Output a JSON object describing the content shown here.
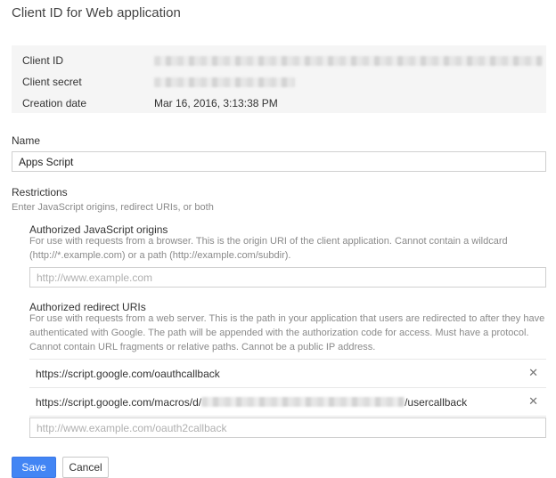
{
  "page": {
    "title": "Client ID for Web application"
  },
  "info": {
    "client_id_label": "Client ID",
    "client_secret_label": "Client secret",
    "creation_date_label": "Creation date",
    "creation_date_value": "Mar 16, 2016, 3:13:38 PM"
  },
  "name": {
    "label": "Name",
    "value": "Apps Script"
  },
  "restrictions": {
    "label": "Restrictions",
    "description": "Enter JavaScript origins, redirect URIs, or both"
  },
  "origins": {
    "label": "Authorized JavaScript origins",
    "help_line1": "For use with requests from a browser. This is the origin URI of the client application. Cannot contain a wildcard",
    "help_line2": "(http://*.example.com) or a path (http://example.com/subdir).",
    "placeholder": "http://www.example.com"
  },
  "redirects": {
    "label": "Authorized redirect URIs",
    "help_line1": "For use with requests from a web server. This is the path in your application that users are redirected to after they have",
    "help_line2": "authenticated with Google. The path will be appended with the authorization code for access. Must have a protocol.",
    "help_line3": "Cannot contain URL fragments or relative paths. Cannot be a public IP address.",
    "uri1": "https://script.google.com/oauthcallback",
    "uri2_prefix": "https://script.google.com/macros/d/",
    "uri2_suffix": "/usercallback",
    "remove_glyph": "✕",
    "placeholder": "http://www.example.com/oauth2callback"
  },
  "buttons": {
    "save": "Save",
    "cancel": "Cancel"
  },
  "colors": {
    "primary": "#4285f4",
    "info_bg": "#f5f5f5"
  }
}
